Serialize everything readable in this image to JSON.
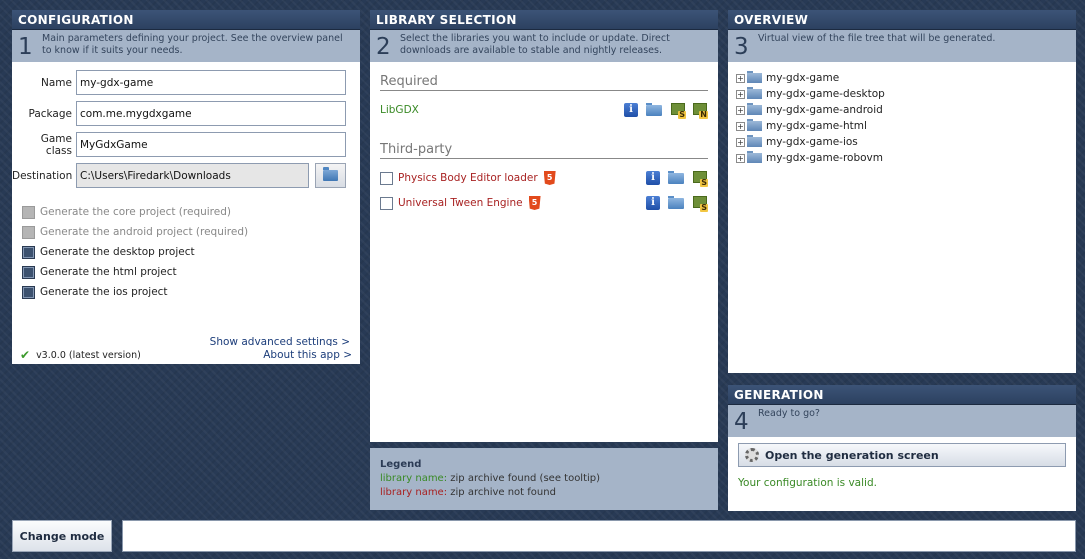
{
  "configuration": {
    "title": "CONFIGURATION",
    "step": "1",
    "description": "Main parameters defining your project. See the overview panel to know if it suits your needs.",
    "fields": {
      "name_label": "Name",
      "name_value": "my-gdx-game",
      "package_label": "Package",
      "package_value": "com.me.mygdxgame",
      "game_class_label": "Game class",
      "game_class_value": "MyGdxGame",
      "destination_label": "Destination",
      "destination_value": "C:\\Users\\Firedark\\Downloads"
    },
    "checks": [
      {
        "label": "Generate the core project (required)",
        "state": "checked-disabled"
      },
      {
        "label": "Generate the android project (required)",
        "state": "checked-disabled"
      },
      {
        "label": "Generate the desktop project",
        "state": "checked"
      },
      {
        "label": "Generate the html project",
        "state": "checked"
      },
      {
        "label": "Generate the ios project",
        "state": "checked"
      }
    ],
    "advanced_link": "Show advanced settings >"
  },
  "version": {
    "text": "v3.0.0 (latest version)",
    "about_link": "About this app >"
  },
  "library": {
    "title": "LIBRARY SELECTION",
    "step": "2",
    "description": "Select the libraries you want to include or update. Direct downloads are available to stable and nightly releases.",
    "required_title": "Required",
    "required_item": "LibGDX",
    "third_party_title": "Third-party",
    "third_party_items": [
      {
        "name": "Physics Body Editor loader"
      },
      {
        "name": "Universal Tween Engine"
      }
    ],
    "html5_badge": "5",
    "dl_stable_letter": "S",
    "dl_nightly_letter": "N"
  },
  "legend": {
    "title": "Legend",
    "found_name": "library name:",
    "found_text": "zip archive found (see tooltip)",
    "notfound_name": "library name:",
    "notfound_text": "zip archive not found"
  },
  "overview": {
    "title": "OVERVIEW",
    "step": "3",
    "description": "Virtual view of the file tree that will be generated.",
    "tree": [
      "my-gdx-game",
      "my-gdx-game-desktop",
      "my-gdx-game-android",
      "my-gdx-game-html",
      "my-gdx-game-ios",
      "my-gdx-game-robovm"
    ],
    "expander_glyph": "+"
  },
  "generation": {
    "title": "GENERATION",
    "step": "4",
    "description": "Ready to go?",
    "button_label": "Open the generation screen",
    "valid_text": "Your configuration is valid."
  },
  "bottom": {
    "change_mode_label": "Change mode"
  },
  "icons": {
    "info": "info-icon",
    "folder": "folder-icon",
    "download": "download-icon",
    "checkmark": "checkmark-icon",
    "gear": "gear-icon",
    "html5": "html5-icon"
  },
  "colors": {
    "background": "#283a55",
    "header": "#2c4160",
    "desc_band": "#a5b4c8",
    "found_green": "#3a8a26",
    "not_found_red": "#a82222",
    "link_blue": "#1c3d7a"
  }
}
